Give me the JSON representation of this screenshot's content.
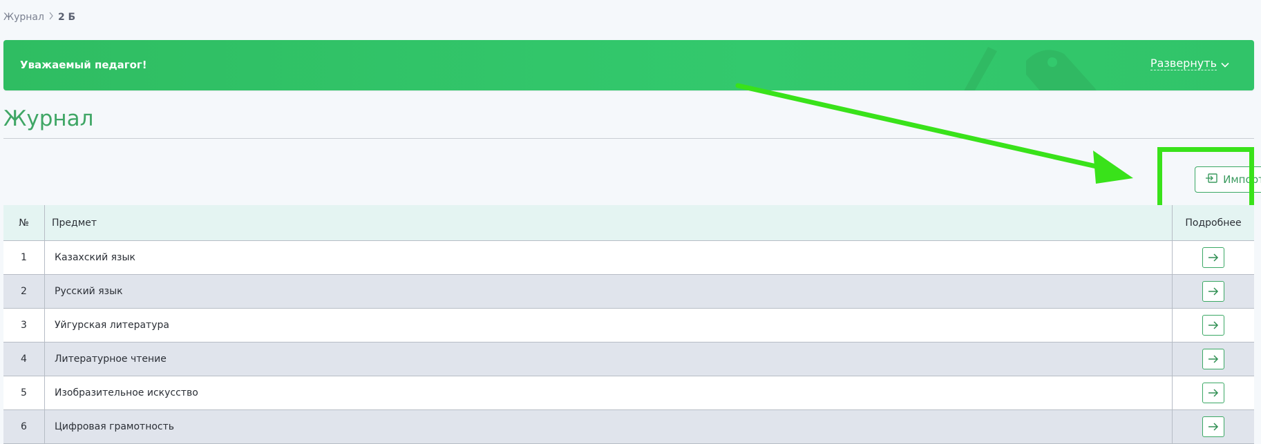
{
  "breadcrumb": {
    "root": "Журнал",
    "current": "2 Б"
  },
  "banner": {
    "title": "Уважаемый педагог!",
    "expand_label": "Развернуть"
  },
  "page": {
    "title": "Журнал"
  },
  "toolbar": {
    "import_label": "Импорт"
  },
  "table": {
    "headers": {
      "number": "№",
      "subject": "Предмет",
      "details": "Подробнее"
    },
    "rows": [
      {
        "number": "1",
        "subject": "Казахский язык"
      },
      {
        "number": "2",
        "subject": "Русский язык"
      },
      {
        "number": "3",
        "subject": "Уйгурская литература"
      },
      {
        "number": "4",
        "subject": "Литературное чтение"
      },
      {
        "number": "5",
        "subject": "Изобразительное искусство"
      },
      {
        "number": "6",
        "subject": "Цифровая грамотность"
      }
    ]
  },
  "icons": {
    "breadcrumb_separator": "chevron-right-icon",
    "expand": "chevron-down-icon",
    "import": "import-icon",
    "row_action": "arrow-right-icon"
  },
  "colors": {
    "accent": "#3aa864",
    "banner": "#33c96d",
    "title": "#3fa665",
    "annotation": "#39e21a",
    "row_alt": "#e0e4ec",
    "header_bg": "#e4f4f2"
  }
}
